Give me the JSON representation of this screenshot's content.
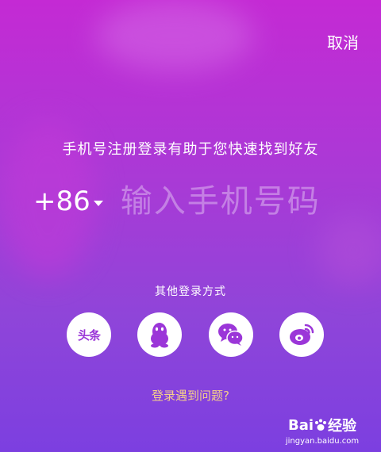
{
  "header": {
    "cancel_label": "取消"
  },
  "subtitle": "手机号注册登录有助于您快速找到好友",
  "phone": {
    "country_code": "+86",
    "placeholder": "输入手机号码"
  },
  "other_login": {
    "label": "其他登录方式",
    "options": [
      {
        "name": "toutiao",
        "label": "头条",
        "icon": "toutiao-icon"
      },
      {
        "name": "qq",
        "icon": "qq-penguin-icon"
      },
      {
        "name": "wechat",
        "icon": "wechat-icon"
      },
      {
        "name": "weibo",
        "icon": "weibo-icon"
      }
    ]
  },
  "problem_link": "登录遇到问题?",
  "watermark": {
    "brand": "Bai",
    "brand2": "经验",
    "url": "jingyan.baidu.com"
  },
  "colors": {
    "accent_purple": "#9b36d8",
    "link_gold": "#f5d08a",
    "text_white": "#ffffff"
  }
}
